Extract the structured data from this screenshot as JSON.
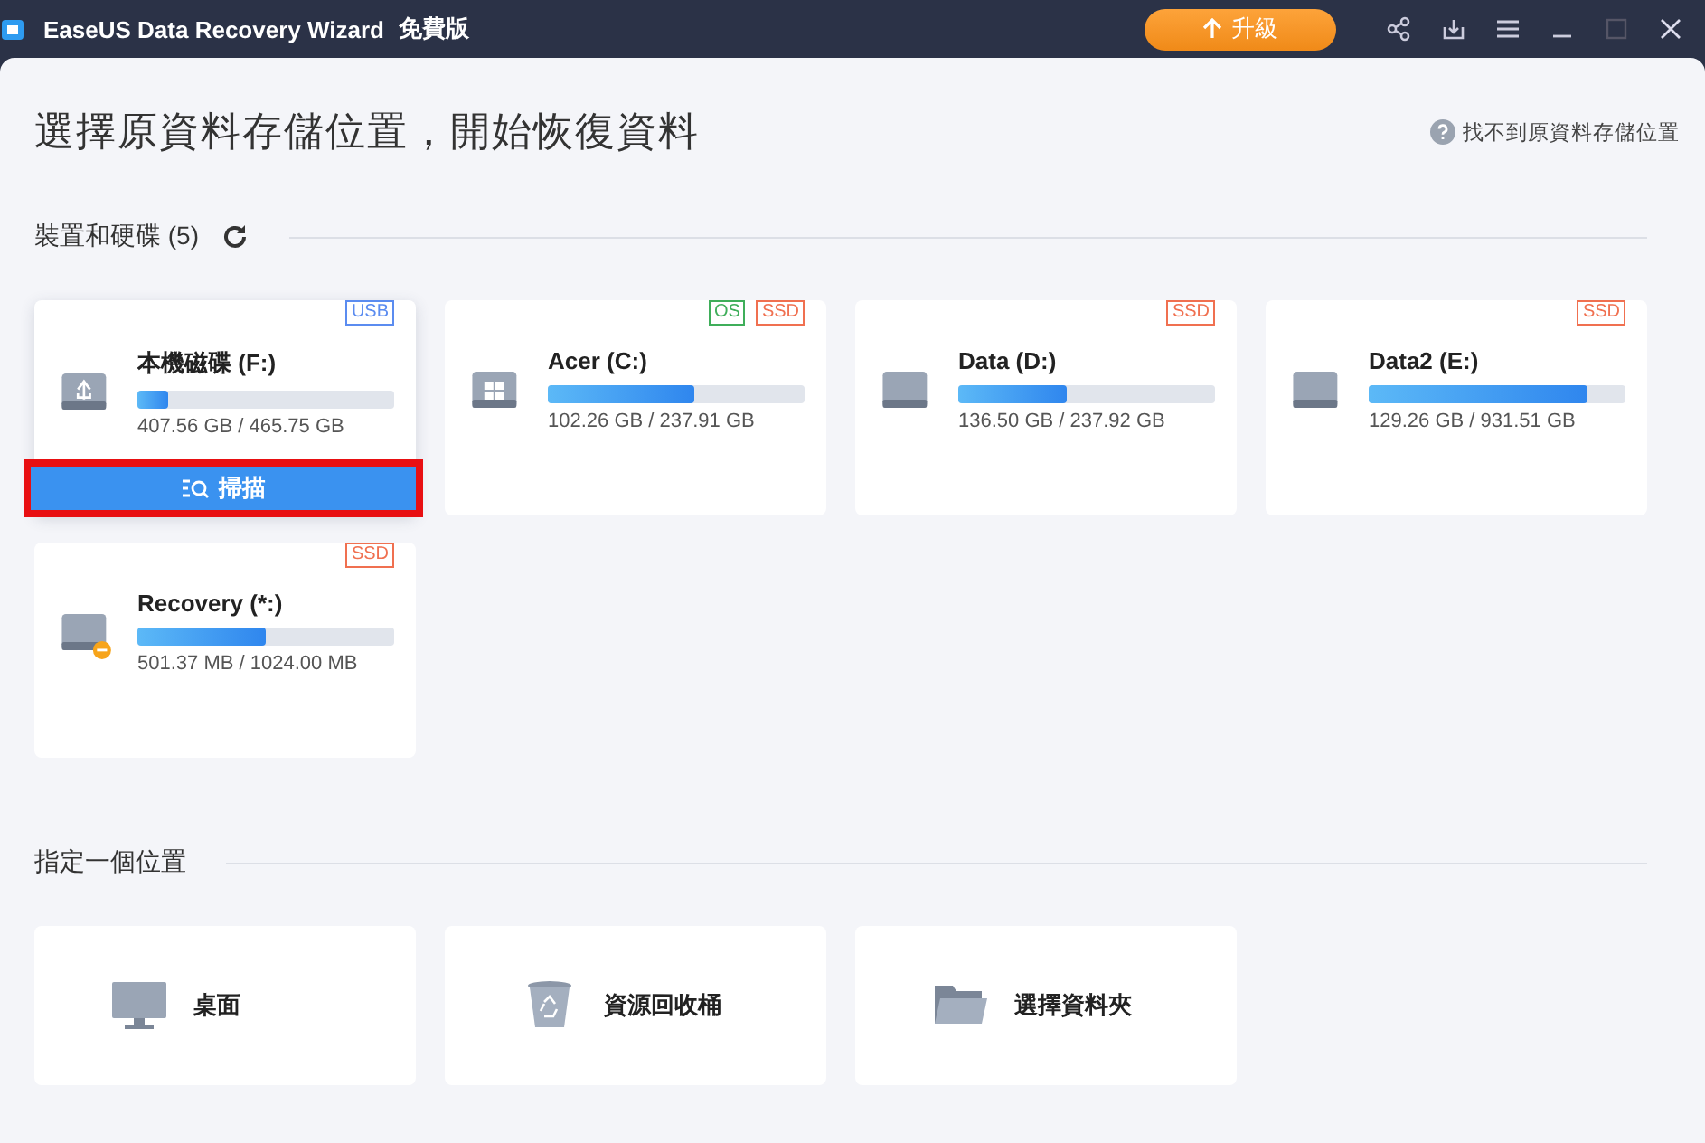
{
  "window": {
    "title": "EaseUS Data Recovery Wizard",
    "edition": "免費版",
    "upgrade_button": "升級"
  },
  "heading": "選擇原資料存儲位置，開始恢復資料",
  "help_link": "找不到原資料存儲位置",
  "devices_section": {
    "title": "裝置和硬碟 (5)"
  },
  "drives": [
    {
      "name": "本機磁碟 (F:)",
      "kind": "usb",
      "tags": [
        {
          "label": "USB",
          "color": "#5b8cf0"
        }
      ],
      "level": 0.12,
      "size": "407.56 GB / 465.75 GB",
      "hovered": true,
      "scan_button": "掃描"
    },
    {
      "name": "Acer (C:)",
      "kind": "windows",
      "tags": [
        {
          "label": "OS",
          "color": "#3fae5a"
        },
        {
          "label": "SSD",
          "color": "#f07050"
        }
      ],
      "level": 0.57,
      "size": "102.26 GB / 237.91 GB",
      "hovered": false
    },
    {
      "name": "Data (D:)",
      "kind": "plain",
      "tags": [
        {
          "label": "SSD",
          "color": "#f07050"
        }
      ],
      "level": 0.42,
      "size": "136.50 GB / 237.92 GB",
      "hovered": false
    },
    {
      "name": "Data2 (E:)",
      "kind": "plain",
      "tags": [
        {
          "label": "SSD",
          "color": "#f07050"
        }
      ],
      "level": 0.85,
      "size": "129.26 GB / 931.51 GB",
      "hovered": false
    },
    {
      "name": "Recovery (*:)",
      "kind": "recovery",
      "tags": [
        {
          "label": "SSD",
          "color": "#f07050"
        }
      ],
      "level": 0.5,
      "size": "501.37 MB / 1024.00 MB",
      "hovered": false
    }
  ],
  "locations_section": {
    "title": "指定一個位置"
  },
  "locations": [
    {
      "kind": "desktop",
      "label": "桌面"
    },
    {
      "kind": "recycle",
      "label": "資源回收桶"
    },
    {
      "kind": "folder",
      "label": "選擇資料夾"
    }
  ]
}
